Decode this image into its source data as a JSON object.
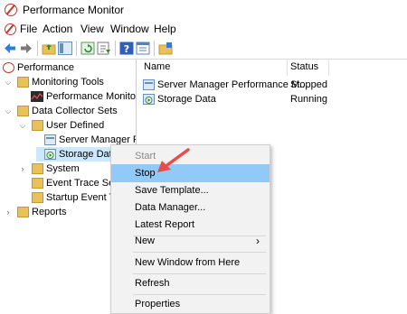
{
  "window": {
    "title": "Performance Monitor"
  },
  "menubar": {
    "items": [
      "File",
      "Action",
      "View",
      "Window",
      "Help"
    ]
  },
  "tree": {
    "root": "Performance",
    "monitoring_tools": "Monitoring Tools",
    "performance_monitor": "Performance Monitor",
    "data_collector_sets": "Data Collector Sets",
    "user_defined": "User Defined",
    "server_manager": "Server Manager Per",
    "storage_data": "Storage Data",
    "system": "System",
    "event_trace": "Event Trace Sessi",
    "startup_event": "Startup Event Tra",
    "reports": "Reports"
  },
  "list": {
    "columns": {
      "name": "Name",
      "status": "Status"
    },
    "rows": [
      {
        "name": "Server Manager Performance M...",
        "status": "Stopped"
      },
      {
        "name": "Storage Data",
        "status": "Running"
      }
    ]
  },
  "context_menu": {
    "start": "Start",
    "stop": "Stop",
    "save_template": "Save Template...",
    "data_manager": "Data Manager...",
    "latest_report": "Latest Report",
    "new": "New",
    "new_window": "New Window from Here",
    "refresh": "Refresh",
    "properties": "Properties"
  },
  "colors": {
    "highlight": "#91c9f7",
    "selected_tree": "#cce8ff",
    "arrow": "#e84d4d"
  }
}
